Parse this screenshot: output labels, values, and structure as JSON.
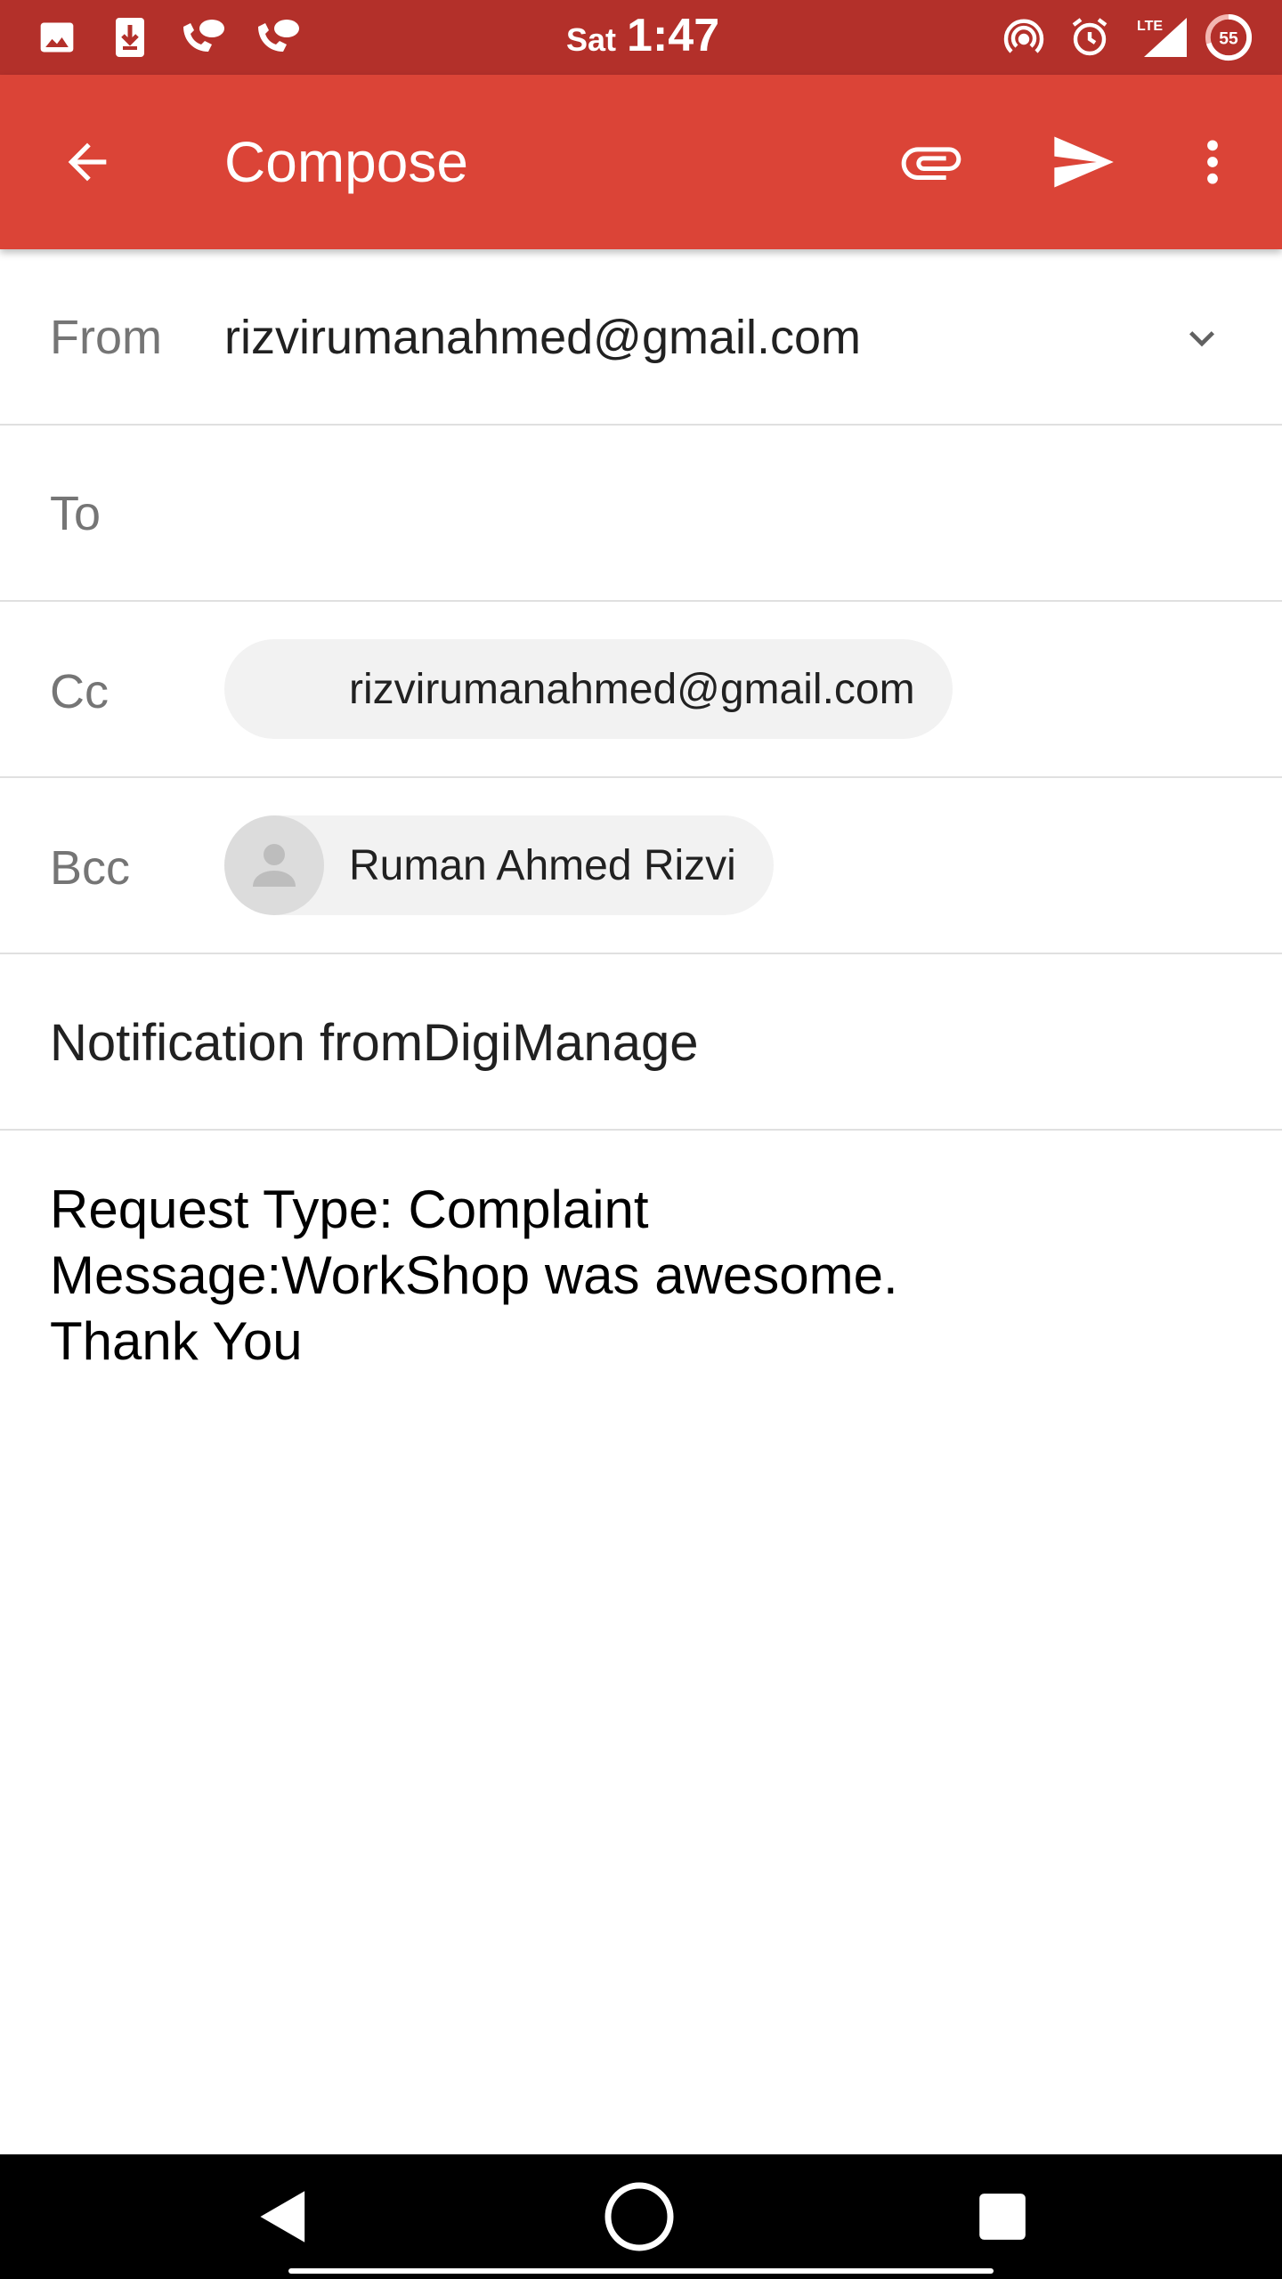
{
  "status_bar": {
    "day": "Sat",
    "time": "1:47",
    "network": "LTE",
    "battery": "55",
    "left_icons": [
      "image-icon",
      "download-icon",
      "call-message-icon",
      "call-message-icon"
    ],
    "right_icons": [
      "hotspot-icon",
      "alarm-icon",
      "signal-icon",
      "battery-icon"
    ]
  },
  "app_bar": {
    "title": "Compose",
    "color": "#db4437",
    "actions": [
      "back-arrow-icon",
      "attach-icon",
      "send-icon",
      "more-vert-icon"
    ]
  },
  "from": {
    "label": "From",
    "value": "rizvirumanahmed@gmail.com"
  },
  "to": {
    "label": "To",
    "value": ""
  },
  "cc": {
    "label": "Cc",
    "chip": "rizvirumanahmed@gmail.com"
  },
  "bcc": {
    "label": "Bcc",
    "chip": "Ruman Ahmed Rizvi"
  },
  "subject": "Notification fromDigiManage",
  "body": {
    "lines": [
      "Request Type: Complaint",
      "Message:WorkShop was awesome.",
      "Thank You"
    ]
  },
  "nav_bar": {
    "buttons": [
      "back-triangle-icon",
      "home-circle-icon",
      "recents-square-icon"
    ]
  }
}
